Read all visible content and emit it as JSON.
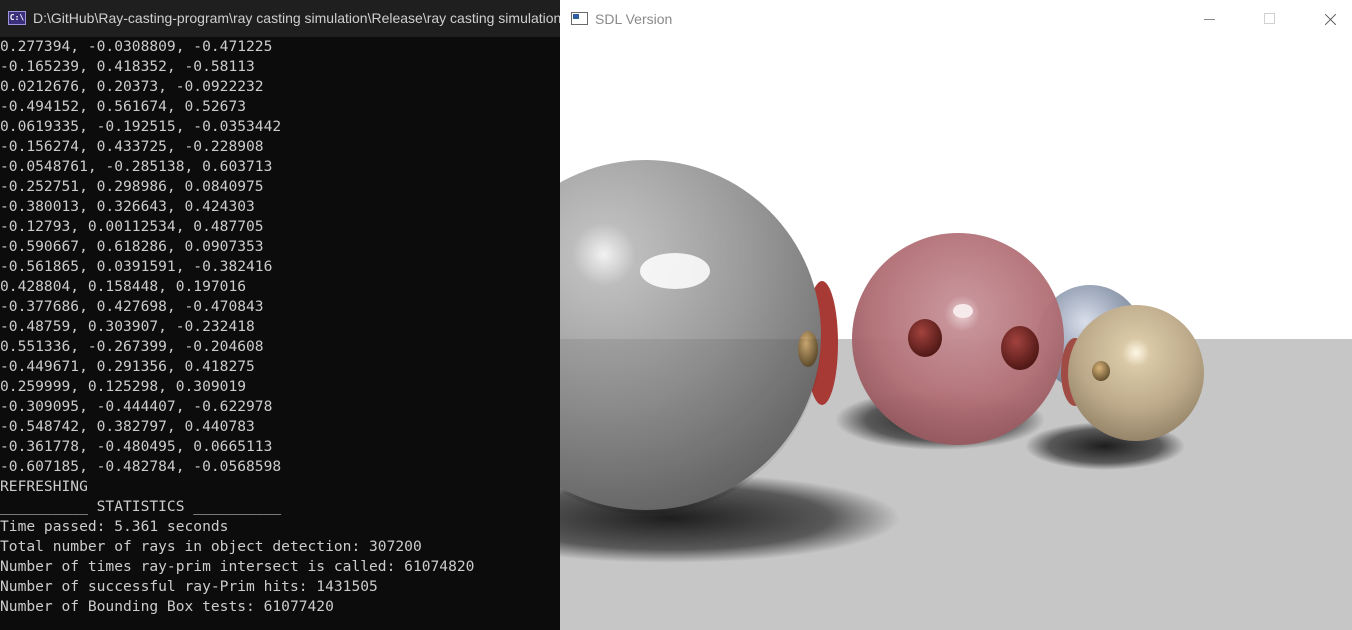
{
  "console_window": {
    "icon_text": "C:\\",
    "title": "D:\\GitHub\\Ray-casting-program\\ray casting simulation\\Release\\ray casting simulation.exe",
    "lines": [
      "0.277394, -0.0308809, -0.471225",
      "-0.165239, 0.418352, -0.58113",
      "0.0212676, 0.20373, -0.0922232",
      "-0.494152, 0.561674, 0.52673",
      "0.0619335, -0.192515, -0.0353442",
      "-0.156274, 0.433725, -0.228908",
      "-0.0548761, -0.285138, 0.603713",
      "-0.252751, 0.298986, 0.0840975",
      "-0.380013, 0.326643, 0.424303",
      "-0.12793, 0.00112534, 0.487705",
      "-0.590667, 0.618286, 0.0907353",
      "-0.561865, 0.0391591, -0.382416",
      "0.428804, 0.158448, 0.197016",
      "-0.377686, 0.427698, -0.470843",
      "-0.48759, 0.303907, -0.232418",
      "0.551336, -0.267399, -0.204608",
      "-0.449671, 0.291356, 0.418275",
      "0.259999, 0.125298, 0.309019",
      "-0.309095, -0.444407, -0.622978",
      "-0.548742, 0.382797, 0.440783",
      "-0.361778, -0.480495, 0.0665113",
      "-0.607185, -0.482784, -0.0568598",
      "REFRESHING",
      "__________ STATISTICS __________",
      "Time passed: 5.361 seconds",
      "Total number of rays in object detection: 307200",
      "Number of times ray-prim intersect is called: 61074820",
      "Number of successful ray-Prim hits: 1431505",
      "Number of Bounding Box tests: 61077420"
    ]
  },
  "sdl_window": {
    "title": "SDL Version",
    "buttons": {
      "minimize": "minimize",
      "maximize": "maximize",
      "close": "close"
    },
    "icon": "window-app-icon"
  },
  "colors": {
    "console_bg": "#0c0c0c",
    "console_text": "#cccccc",
    "sky": "#ffffff",
    "floor": "#c6c6c6",
    "sphere_gray": "#9a9a9a",
    "sphere_red": "#b97a80",
    "sphere_blue": "#8a97ab",
    "sphere_tan": "#c7b693"
  }
}
